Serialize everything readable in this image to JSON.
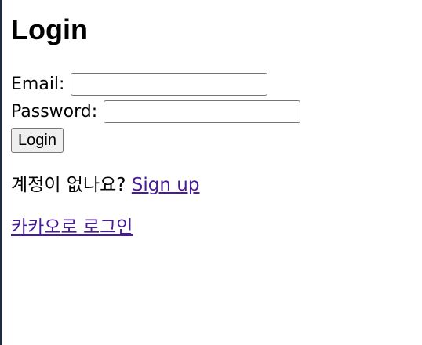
{
  "page": {
    "title": "Login"
  },
  "form": {
    "email_label": "Email:",
    "email_value": "",
    "password_label": "Password:",
    "password_value": "",
    "submit_label": "Login"
  },
  "signup": {
    "prompt": "계정이 없나요? ",
    "link_label": "Sign up"
  },
  "kakao": {
    "link_label": "카카오로 로그인"
  },
  "colors": {
    "link_visited": "#4a1a9c",
    "text": "#000000",
    "left_edge": "#1f2a44"
  }
}
